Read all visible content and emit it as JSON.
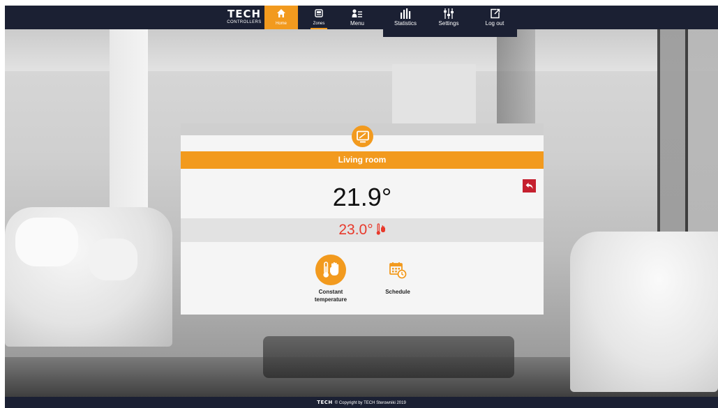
{
  "brand": {
    "name": "TECH",
    "sub": "CONTROLLERS"
  },
  "nav": {
    "items": [
      {
        "label": "Home",
        "icon": "home-icon",
        "active": true
      },
      {
        "label": "Zones",
        "icon": "zones-icon"
      },
      {
        "label": "Menu",
        "icon": "menu-icon"
      },
      {
        "label": "Statistics",
        "icon": "statistics-icon"
      },
      {
        "label": "Settings",
        "icon": "settings-icon"
      },
      {
        "label": "Log out",
        "icon": "logout-icon"
      }
    ]
  },
  "room": {
    "name": "Living room",
    "current_temp": "21.9°",
    "set_temp": "23.0°"
  },
  "modes": [
    {
      "label_line1": "Constant",
      "label_line2": "temperature",
      "icon": "hand-thermometer-icon",
      "active": true
    },
    {
      "label_line1": "Schedule",
      "label_line2": "",
      "icon": "calendar-clock-icon",
      "active": false
    }
  ],
  "footer": {
    "brand": "TECH",
    "text": "© Copyright by TECH Sterowniki 2019"
  },
  "colors": {
    "accent": "#f29a1e",
    "nav_bg": "#1b2033",
    "back_button": "#c5202e",
    "set_temp": "#e8392b"
  }
}
